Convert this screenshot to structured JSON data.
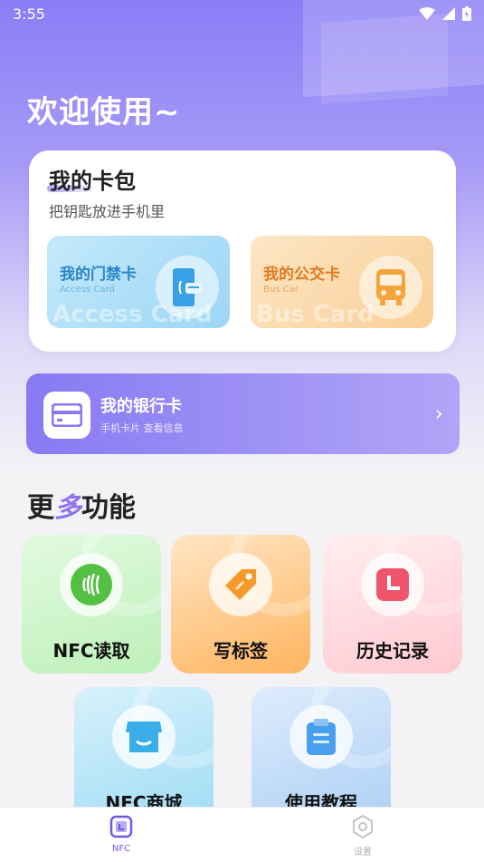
{
  "status_bar": {
    "time": "3:55"
  },
  "welcome": "欢迎使用~",
  "wallet": {
    "title": "我的卡包",
    "subtitle": "把钥匙放进手机里",
    "access_card": {
      "title": "我的门禁卡",
      "subtitle": "Access Card",
      "watermark": "Access Card",
      "icon": "door-card-icon"
    },
    "bus_card": {
      "title": "我的公交卡",
      "subtitle": "Bus Car",
      "watermark": "Bus Card",
      "icon": "bus-icon"
    }
  },
  "bank_card": {
    "title": "我的银行卡",
    "subtitle": "手机卡片  查看信息",
    "icon": "bank-card-icon"
  },
  "more": {
    "title_pre": "更",
    "title_accent": "多",
    "title_post": "功能"
  },
  "features": [
    {
      "label": "NFC读取",
      "icon": "nfc-icon"
    },
    {
      "label": "写标签",
      "icon": "tag-icon"
    },
    {
      "label": "历史记录",
      "icon": "clock-icon"
    },
    {
      "label": "NFC商城",
      "icon": "shop-icon"
    },
    {
      "label": "使用教程",
      "icon": "clipboard-icon"
    }
  ],
  "bottom_nav": [
    {
      "label": "NFC",
      "active": true
    },
    {
      "label": "设置",
      "active": false
    }
  ],
  "colors": {
    "accent": "#8979f3",
    "nav_active": "#6b5ce7"
  }
}
